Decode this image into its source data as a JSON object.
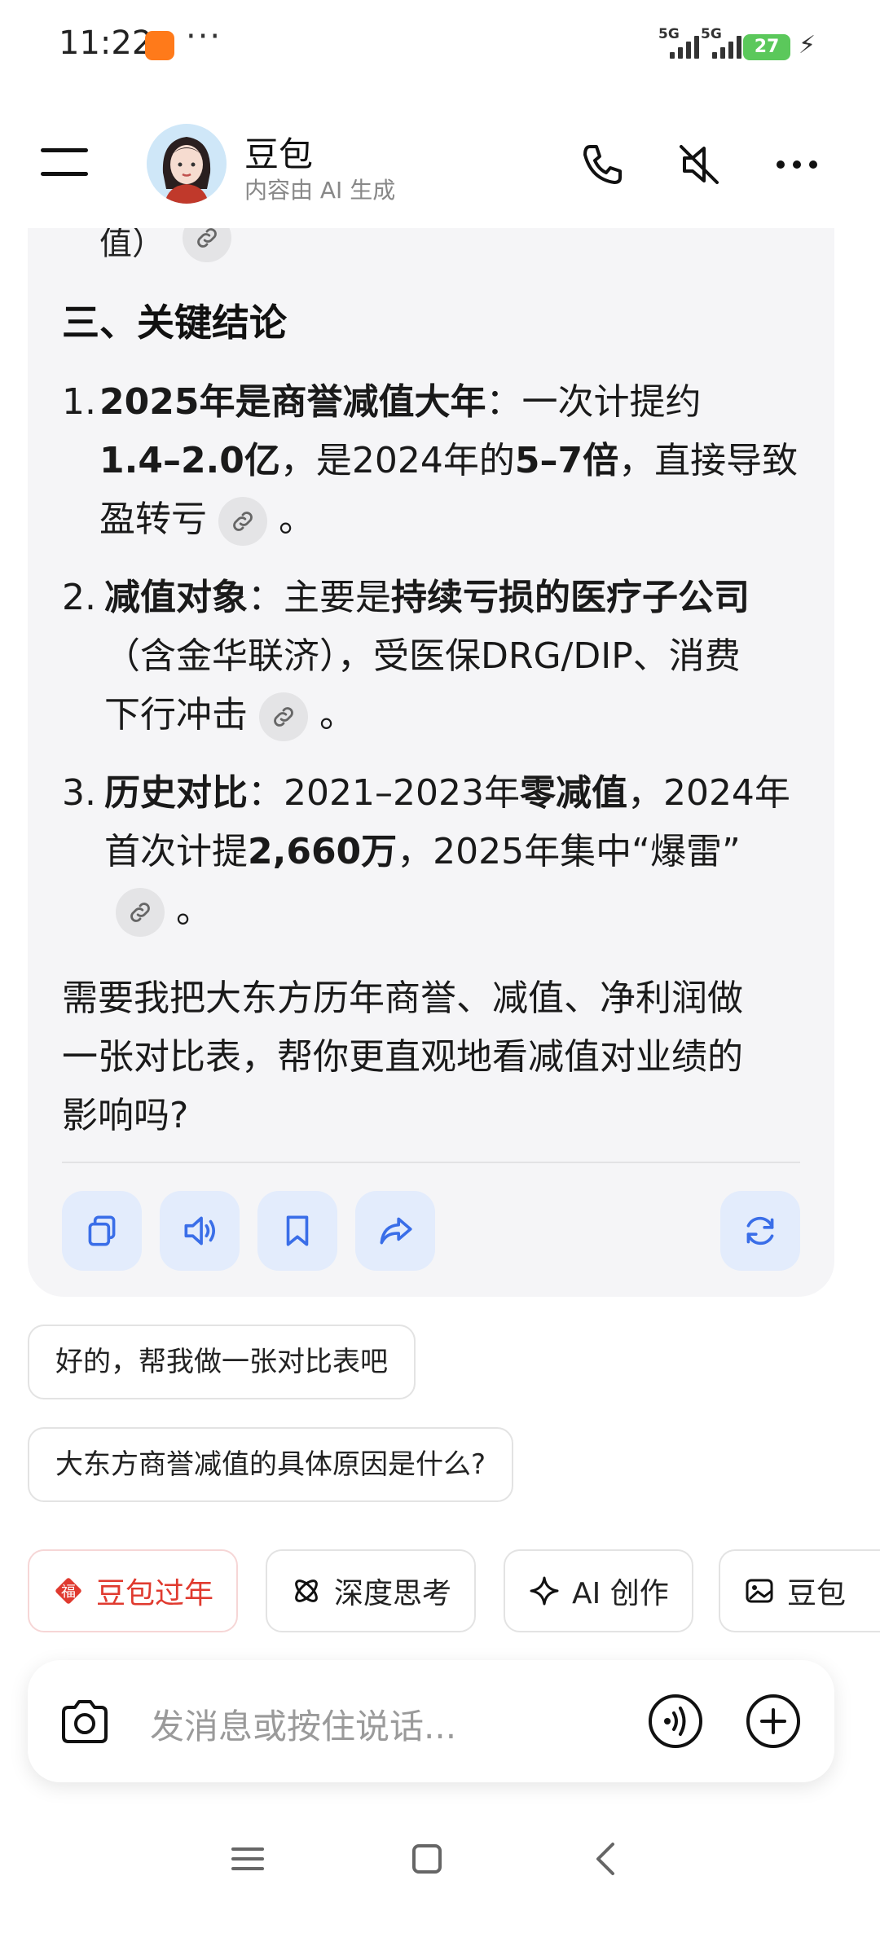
{
  "status_bar": {
    "time": "11:22",
    "more": "···",
    "signal1_label": "5G",
    "signal2_label": "5G",
    "battery": "27"
  },
  "header": {
    "name": "豆包",
    "subtitle": "内容由 AI 生成"
  },
  "message": {
    "cut_off_text": "值）",
    "section_title": "三、关键结论",
    "item1": {
      "num": "1.",
      "l1_b": "2025年是商誉减值大年",
      "l1_t": "：一次计提约",
      "l2_b1": "1.4–2.0亿",
      "l2_t1": "，是2024年的",
      "l2_b2": "5–7倍",
      "l2_t2": "，直接导致",
      "l3_t": "盈转亏",
      "l3_end": "。"
    },
    "item2": {
      "num": "2.",
      "l1_b1": "减值对象",
      "l1_t": "：主要是",
      "l1_b2": "持续亏损的医疗子公司",
      "l2_t": "（含金华联济），受医保DRG/DIP、消费",
      "l3_t": "下行冲击",
      "l3_end": "。"
    },
    "item3": {
      "num": "3.",
      "l1_b1": "历史对比",
      "l1_t1": "：2021–2023年",
      "l1_b2": "零减值",
      "l1_t2": "，2024年",
      "l2_t1": "首次计提",
      "l2_b": "2,660万",
      "l2_t2": "，2025年集中“爆雷”",
      "l3_end": "。"
    },
    "closing": {
      "l1": "需要我把大东方历年商誉、减值、净利润做",
      "l2": "一张对比表，帮你更直观地看减值对业绩的",
      "l3": "影响吗?"
    }
  },
  "suggestions": [
    "好的，帮我做一张对比表吧",
    "大东方商誉减值的具体原因是什么?"
  ],
  "features": [
    {
      "label": "豆包过年",
      "icon": "fu-icon"
    },
    {
      "label": "深度思考",
      "icon": "atom-icon"
    },
    {
      "label": "AI 创作",
      "icon": "sparkle-icon"
    },
    {
      "label": "豆包",
      "icon": "image-icon"
    }
  ],
  "input": {
    "placeholder": "发消息或按住说话..."
  },
  "colors": {
    "accent": "#3a6ee8",
    "action_bg": "#e3ecfc",
    "card_bg": "#f5f5f7",
    "festival_red": "#e03a2f"
  }
}
